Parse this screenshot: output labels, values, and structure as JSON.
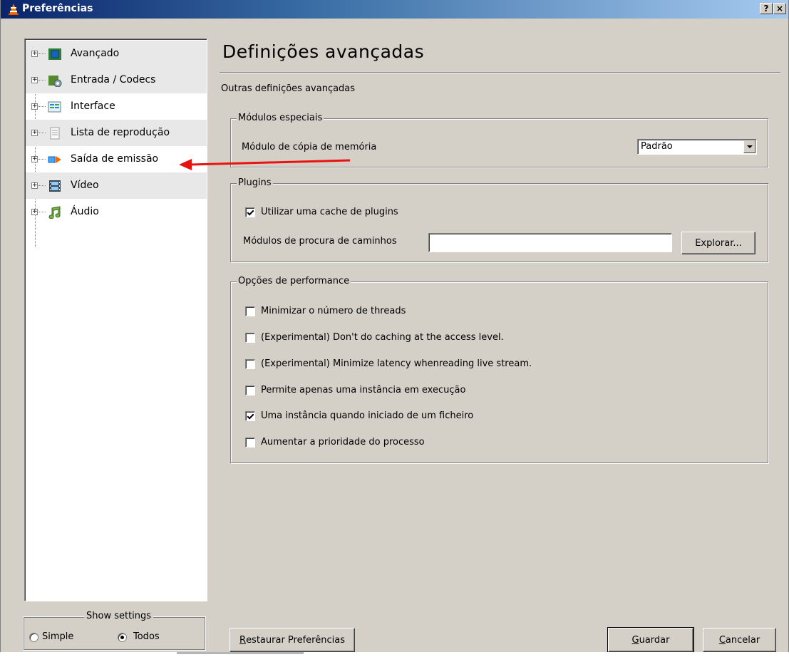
{
  "window": {
    "title": "Preferências",
    "help_glyph": "?",
    "close_glyph": "×"
  },
  "tree": {
    "items": [
      {
        "label": "Avançado",
        "icon": "chip-icon"
      },
      {
        "label": "Entrada / Codecs",
        "icon": "codec-icon"
      },
      {
        "label": "Interface",
        "icon": "interface-icon"
      },
      {
        "label": "Lista de reprodução",
        "icon": "playlist-icon"
      },
      {
        "label": "Saída de emissão",
        "icon": "stream-output-icon"
      },
      {
        "label": "Vídeo",
        "icon": "video-film-icon"
      },
      {
        "label": "Áudio",
        "icon": "music-note-icon"
      }
    ],
    "expander_glyph": "+"
  },
  "show_settings": {
    "legend": "Show settings",
    "options": [
      {
        "label": "Simple",
        "selected": false
      },
      {
        "label": "Todos",
        "selected": true
      }
    ]
  },
  "main": {
    "title": "Definições avançadas",
    "subtitle": "Outras definições avançadas",
    "special_modules": {
      "legend": "Módulos especiais",
      "memcpy_label": "Módulo de cópia de memória",
      "memcpy_value": "Padrão"
    },
    "plugins": {
      "legend": "Plugins",
      "cache_label": "Utilizar uma cache de plugins",
      "cache_checked": true,
      "search_paths_label": "Módulos de procura de caminhos",
      "search_paths_value": "",
      "browse_label": "Explorar..."
    },
    "performance": {
      "legend": "Opções de performance",
      "options": [
        {
          "label": "Minimizar o número de threads",
          "checked": false
        },
        {
          "label": "(Experimental) Don't do caching at the access level.",
          "checked": false
        },
        {
          "label": "(Experimental) Minimize latency whenreading live stream.",
          "checked": false
        },
        {
          "label": "Permite apenas uma instância em execução",
          "checked": false
        },
        {
          "label": "Uma instância quando iniciado de um ficheiro",
          "checked": true
        },
        {
          "label": "Aumentar a prioridade do processo",
          "checked": false
        }
      ]
    }
  },
  "footer": {
    "reset_first": "R",
    "reset_rest": "estaurar Preferências",
    "save_first": "G",
    "save_rest": "uardar",
    "cancel_first": "C",
    "cancel_rest": "ancelar"
  },
  "colors": {
    "annotation_arrow": "#e8130f",
    "dialog_face": "#d4d0c8",
    "title_gradient_start": "#0a246a"
  }
}
